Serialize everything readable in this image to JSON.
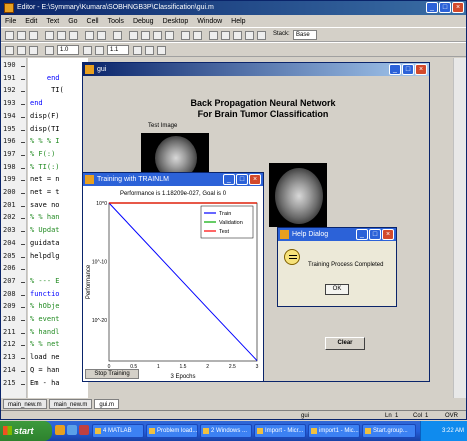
{
  "editor": {
    "title": "Editor - E:\\Symmary\\Kumara\\SOBHNGB3P\\Classification\\gui.m",
    "menu": [
      "File",
      "Edit",
      "Text",
      "Go",
      "Cell",
      "Tools",
      "Debug",
      "Desktop",
      "Window",
      "Help"
    ],
    "toolbar_fields": {
      "step_minus": "1.0",
      "step_plus": "1.1",
      "stack_label": "Stack:",
      "stack_value": "Base"
    },
    "line_numbers": [
      "190",
      "191",
      "192",
      "193",
      "194",
      "195",
      "196",
      "197",
      "198",
      "199",
      "200",
      "201",
      "202",
      "203",
      "204",
      "205",
      "206",
      "207",
      "208",
      "209",
      "210",
      "211",
      "212",
      "213",
      "214",
      "215"
    ],
    "code_lines": [
      {
        "text": "",
        "color": "black"
      },
      {
        "text": "    end",
        "color": "blue"
      },
      {
        "text": "     TI(",
        "color": "black"
      },
      {
        "text": "end",
        "color": "blue"
      },
      {
        "text": "disp(F)",
        "color": "black"
      },
      {
        "text": "disp(TI",
        "color": "black"
      },
      {
        "text": "% % % I",
        "color": "green"
      },
      {
        "text": "% F(:)",
        "color": "green"
      },
      {
        "text": "% TI(:)",
        "color": "green"
      },
      {
        "text": "net = n",
        "color": "black"
      },
      {
        "text": "net = t",
        "color": "black"
      },
      {
        "text": "save no",
        "color": "black"
      },
      {
        "text": "% % han",
        "color": "green"
      },
      {
        "text": "% Updat",
        "color": "green"
      },
      {
        "text": "guidata",
        "color": "black"
      },
      {
        "text": "helpdlg",
        "color": "black"
      },
      {
        "text": "",
        "color": "black"
      },
      {
        "text": "% --- E",
        "color": "green"
      },
      {
        "text": "functio",
        "color": "blue"
      },
      {
        "text": "% hObje",
        "color": "green"
      },
      {
        "text": "% event",
        "color": "green"
      },
      {
        "text": "% handl",
        "color": "green"
      },
      {
        "text": "% % net",
        "color": "green"
      },
      {
        "text": "load ne",
        "color": "black"
      },
      {
        "text": "Q = han",
        "color": "black"
      },
      {
        "text": "Em - ha",
        "color": "black"
      }
    ],
    "tabs": [
      "main_new.m",
      "main_new.m",
      "gui.m"
    ],
    "status": {
      "file": "gui",
      "ln_label": "Ln",
      "ln": "1",
      "col_label": "Col",
      "col": "1",
      "mode": "OVR"
    }
  },
  "gui_window": {
    "title": "gui",
    "heading_line1": "Back Propagation Neural Network",
    "heading_line2": "For Brain Tumor Classification",
    "test_image_label": "Test Image",
    "clear_label": "Clear"
  },
  "training_window": {
    "title": "Training with TRAINLM",
    "performance_title": "Performance is 1.18209e-027, Goal is 0",
    "ylabel": "Performance",
    "xlabel": "3 Epochs",
    "stop_label": "Stop Training",
    "chart_data": {
      "type": "line",
      "title": "Performance is 1.18209e-027, Goal is 0",
      "xlabel": "3 Epochs",
      "ylabel": "Performance",
      "x_ticks": [
        "0",
        "0.5",
        "1",
        "1.5",
        "2",
        "2.5",
        "3"
      ],
      "y_ticks": [
        "10^0",
        "10^-10",
        "10^-20"
      ],
      "y_scale": "log",
      "xlim": [
        0,
        3
      ],
      "ylim": [
        1e-27,
        1
      ],
      "legend_position": "top-right",
      "series": [
        {
          "name": "Train",
          "color": "#0000ff",
          "x": [
            0,
            1,
            2,
            3
          ],
          "y": [
            1,
            1e-09,
            1e-18,
            1.18209e-27
          ]
        },
        {
          "name": "Validation",
          "color": "#00aa00",
          "x": [
            0,
            3
          ],
          "y": [
            1,
            1
          ]
        },
        {
          "name": "Test",
          "color": "#ff0000",
          "x": [
            0,
            3
          ],
          "y": [
            1,
            1
          ]
        }
      ]
    }
  },
  "help_dialog": {
    "title": "Help Dialog",
    "message": "Training Process Completed",
    "ok_label": "OK"
  },
  "taskbar": {
    "start_label": "start",
    "tasks": [
      "4 MATLAB",
      "Problem load...",
      "2 Windows ...",
      "Import - Micr...",
      "import1 - Mic...",
      "Start.group..."
    ],
    "clock": "3:22 AM"
  },
  "colors": {
    "title_blue": "#0a246a",
    "xp_blue": "#2c62d8",
    "taskbar": "#245edb",
    "start_green": "#2e822e"
  }
}
